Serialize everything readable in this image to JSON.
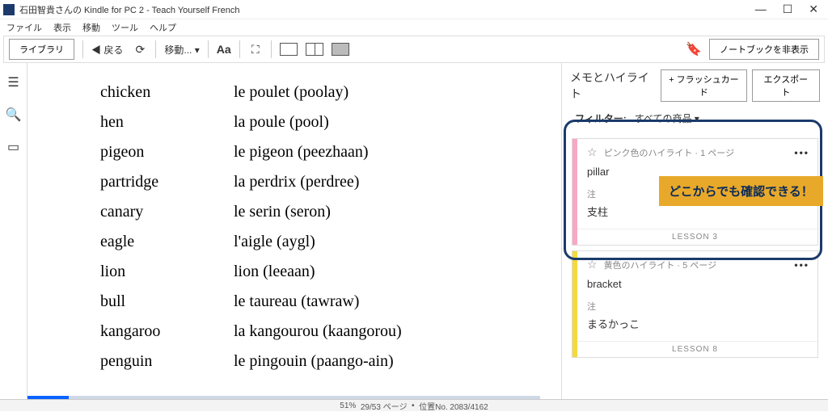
{
  "titlebar": {
    "title": "石田智貴さんの Kindle for PC 2 - Teach Yourself French"
  },
  "menubar": [
    "ファイル",
    "表示",
    "移動",
    "ツール",
    "ヘルプ"
  ],
  "toolbar": {
    "library": "ライブラリ",
    "back": "戻る",
    "move": "移動...",
    "font": "Aa",
    "notebook_hide": "ノートブックを非表示"
  },
  "vocab": [
    {
      "en": "chicken",
      "fr": "le poulet (poolay)"
    },
    {
      "en": "hen",
      "fr": "la poule (pool)"
    },
    {
      "en": "pigeon",
      "fr": "le pigeon (peezhaan)"
    },
    {
      "en": "partridge",
      "fr": "la perdrix (perdree)"
    },
    {
      "en": "canary",
      "fr": "le serin (seron)"
    },
    {
      "en": "eagle",
      "fr": "l'aigle (aygl)"
    },
    {
      "en": "lion",
      "fr": "lion (leeaan)"
    },
    {
      "en": "bull",
      "fr": "le taureau (tawraw)"
    },
    {
      "en": "kangaroo",
      "fr": "la kangourou (kaangorou)"
    },
    {
      "en": "penguin",
      "fr": "le pingouin (paango-ain)"
    }
  ],
  "sidebar": {
    "title": "メモとハイライト",
    "flashcard_btn": "+ フラッシュカード",
    "export_btn": "エクスポート",
    "filter_label": "フィルター:",
    "filter_value": "すべての商品",
    "highlights": [
      {
        "meta": "ピンク色のハイライト · 1 ページ",
        "word": "pillar",
        "note_label": "注",
        "note": "支柱",
        "lesson": "LESSON 3"
      },
      {
        "meta": "黄色のハイライト · 5 ページ",
        "word": "bracket",
        "note_label": "注",
        "note": "まるかっこ",
        "lesson": "LESSON 8"
      }
    ]
  },
  "callout": "どこからでも確認できる！",
  "status": {
    "percent": "51%",
    "pages": "29/53 ページ",
    "location": "位置No. 2083/4162"
  }
}
